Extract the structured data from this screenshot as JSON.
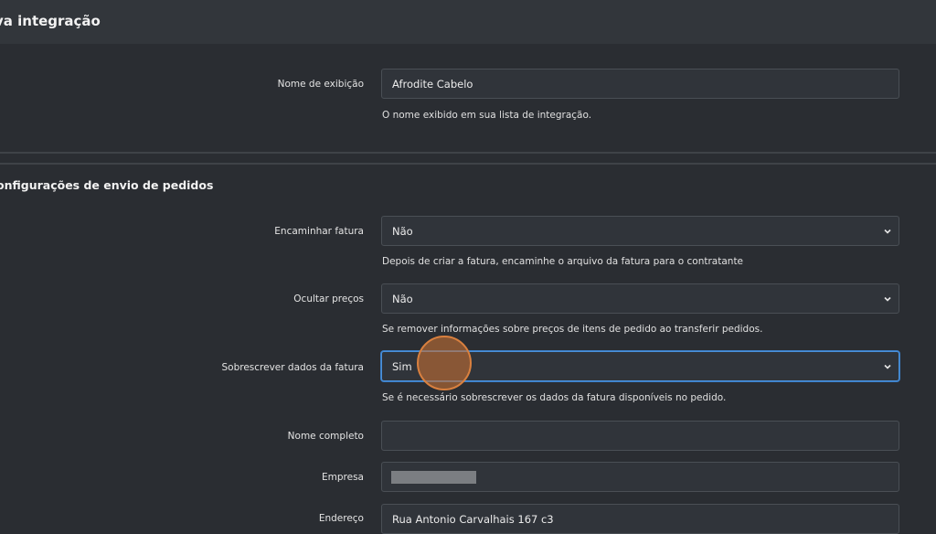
{
  "header": {
    "title": "va integração"
  },
  "display_name": {
    "label": "Nome de exibição",
    "value": "Afrodite Cabelo",
    "help": "O nome exibido em sua lista de integração."
  },
  "section": {
    "title": "onfigurações de envio de pedidos"
  },
  "forward_invoice": {
    "label": "Encaminhar fatura",
    "value": "Não",
    "help": "Depois de criar a fatura, encaminhe o arquivo da fatura para o contratante"
  },
  "hide_prices": {
    "label": "Ocultar preços",
    "value": "Não",
    "help": "Se remover informações sobre preços de itens de pedido ao transferir pedidos."
  },
  "overwrite_invoice": {
    "label": "Sobrescrever dados da fatura",
    "value": "Sim",
    "help": "Se é necessário sobrescrever os dados da fatura disponíveis no pedido."
  },
  "full_name": {
    "label": "Nome completo",
    "value": ""
  },
  "company": {
    "label": "Empresa"
  },
  "address": {
    "label": "Endereço",
    "value": "Rua Antonio Carvalhais 167 c3"
  },
  "icons": {
    "select": "chevron-down-icon",
    "cursor": "cursor-highlight"
  },
  "colors": {
    "background": "#2a2d32",
    "focus": "#4a90d9",
    "cursor": "#d9803f"
  }
}
